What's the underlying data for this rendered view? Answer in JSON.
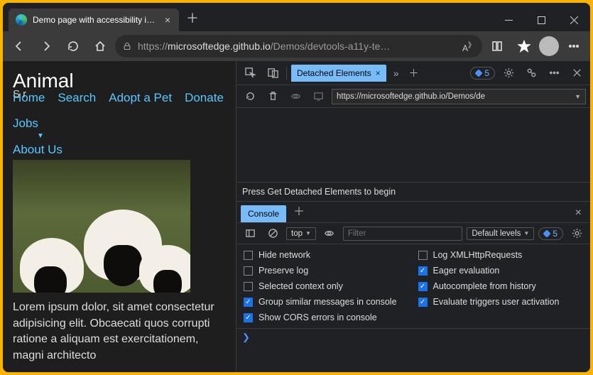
{
  "window": {
    "tab_title": "Demo page with accessibility iss…",
    "url_prefix": "https://",
    "url_host": "microsoftedge.github.io",
    "url_path": "/Demos/devtools-a11y-te…"
  },
  "page": {
    "heading": "Animal",
    "sub": "S           r",
    "nav": {
      "home": "Home",
      "search": "Search",
      "adopt": "Adopt a Pet",
      "donate": "Donate",
      "jobs": "Jobs",
      "about": "About Us"
    },
    "paragraph": "Lorem ipsum dolor, sit amet consectetur adipisicing elit. Obcaecati quos corrupti ratione a aliquam est exercitationem, magni architecto"
  },
  "devtools": {
    "tab": "Detached Elements",
    "issues_count": "5",
    "frame_url": "https://microsoftedge.github.io/Demos/de",
    "detached_msg": "Press Get Detached Elements to begin",
    "drawer_tab": "Console",
    "context": "top",
    "filter_placeholder": "Filter",
    "levels": "Default levels",
    "issues2": "5",
    "settings": {
      "hide_network": "Hide network",
      "preserve_log": "Preserve log",
      "selected_ctx": "Selected context only",
      "group_similar": "Group similar messages in console",
      "show_cors": "Show CORS errors in console",
      "log_xhr": "Log XMLHttpRequests",
      "eager": "Eager evaluation",
      "autocomplete": "Autocomplete from history",
      "eval_trigger": "Evaluate triggers user activation"
    },
    "prompt": "❯"
  }
}
